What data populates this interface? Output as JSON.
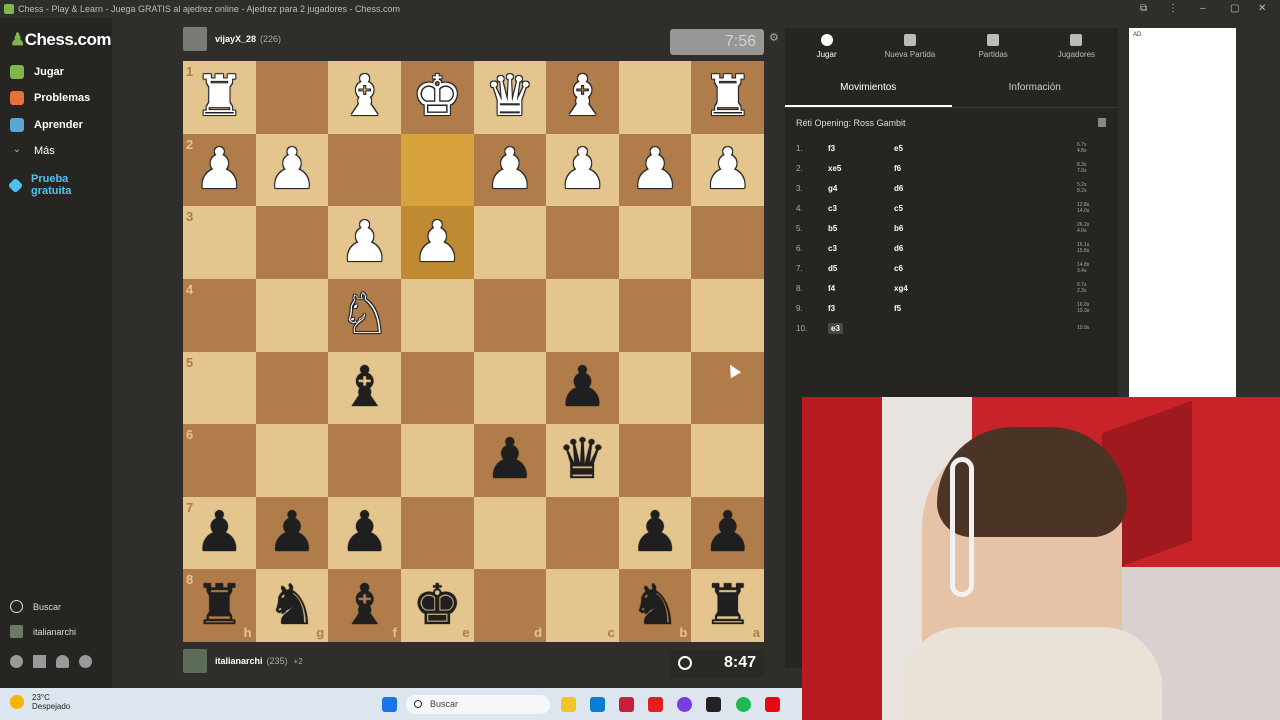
{
  "window": {
    "title": "Chess - Play & Learn - Juega GRATIS al ajedrez online - Ajedrez para 2 jugadores - Chess.com"
  },
  "sidebar": {
    "logo": "Chess.com",
    "items": [
      {
        "label": "Jugar",
        "icon": "play-hand-icon",
        "color": "#81b64c"
      },
      {
        "label": "Problemas",
        "icon": "puzzle-icon",
        "color": "#e6723a"
      },
      {
        "label": "Aprender",
        "icon": "learn-icon",
        "color": "#5aa6d6"
      },
      {
        "label": "Más",
        "icon": "chevron-down-icon",
        "color": "#bbbbbb"
      },
      {
        "label": "Prueba gratuita",
        "icon": "diamond-icon",
        "color": "#4ec3f0"
      }
    ],
    "search_label": "Buscar",
    "user": "italianarchi"
  },
  "top_player": {
    "name": "vijayX_28",
    "rating": "(226)",
    "clock": "7:56"
  },
  "bottom_player": {
    "name": "italianarchi",
    "rating": "(235)",
    "extra": "+2",
    "clock": "8:47"
  },
  "board": {
    "ranks": [
      "1",
      "2",
      "3",
      "4",
      "5",
      "6",
      "7",
      "8"
    ],
    "files": [
      "h",
      "g",
      "f",
      "e",
      "d",
      "c",
      "b",
      "a"
    ],
    "squares": [
      [
        "♜",
        "",
        "♝",
        "♚",
        "♛",
        "♝",
        "",
        "♜"
      ],
      [
        "♟",
        "♟",
        "",
        "",
        "♟",
        "♟",
        "♟",
        "♟"
      ],
      [
        "",
        "",
        "♟",
        "♟",
        "",
        "",
        "",
        ""
      ],
      [
        "",
        "",
        "♘",
        "",
        "",
        "",
        "",
        ""
      ],
      [
        "",
        "",
        "♝",
        "",
        "",
        "♟",
        "",
        ""
      ],
      [
        "",
        "",
        "",
        "",
        "♟",
        "♛",
        "",
        ""
      ],
      [
        "♟",
        "♟",
        "♟",
        "",
        "",
        "",
        "♟",
        "♟"
      ],
      [
        "♜",
        "♞",
        "♝",
        "♚",
        "",
        "",
        "♞",
        "♜"
      ]
    ],
    "colors": [
      [
        "w",
        "",
        "w",
        "w",
        "w",
        "w",
        "",
        "w"
      ],
      [
        "w",
        "w",
        "",
        "",
        "w",
        "w",
        "w",
        "w"
      ],
      [
        "",
        "",
        "w",
        "w",
        "",
        "",
        "",
        ""
      ],
      [
        "",
        "",
        "w",
        "",
        "",
        "",
        "",
        ""
      ],
      [
        "",
        "",
        "b",
        "",
        "",
        "b",
        "",
        ""
      ],
      [
        "",
        "",
        "",
        "",
        "b",
        "b",
        "",
        ""
      ],
      [
        "b",
        "b",
        "b",
        "",
        "",
        "",
        "b",
        "b"
      ],
      [
        "b",
        "b",
        "b",
        "b",
        "",
        "",
        "b",
        "b"
      ]
    ]
  },
  "panel": {
    "tabs": [
      {
        "label": "Jugar",
        "icon": "stopwatch-icon"
      },
      {
        "label": "Nueva Partida",
        "icon": "plus-icon"
      },
      {
        "label": "Partidas",
        "icon": "grid-icon"
      },
      {
        "label": "Jugadores",
        "icon": "players-icon"
      }
    ],
    "subtabs": [
      "Movimientos",
      "Información"
    ],
    "opening": "Réti Opening: Ross Gambit",
    "moves": [
      {
        "n": "1.",
        "w": "f3",
        "b": "e5",
        "tw": "6.7s",
        "tb": "4.8s"
      },
      {
        "n": "2.",
        "w": "xe5",
        "b": "f6",
        "tw": "8.3s",
        "tb": "7.0s"
      },
      {
        "n": "3.",
        "w": "g4",
        "b": "d6",
        "tw": "5.2s",
        "tb": "9.2s"
      },
      {
        "n": "4.",
        "w": "c3",
        "b": "c5",
        "tw": "12.8s",
        "tb": "14.0s"
      },
      {
        "n": "5.",
        "w": "b5",
        "b": "b6",
        "tw": "26.2s",
        "tb": "4.0s"
      },
      {
        "n": "6.",
        "w": "c3",
        "b": "d6",
        "tw": "16.1s",
        "tb": "15.8s"
      },
      {
        "n": "7.",
        "w": "d5",
        "b": "c6",
        "tw": "14.8s",
        "tb": "3.4s"
      },
      {
        "n": "8.",
        "w": "f4",
        "b": "xg4",
        "tw": "6.7s",
        "tb": "2.3s"
      },
      {
        "n": "9.",
        "w": "f3",
        "b": "f5",
        "tw": "16.0s",
        "tb": "10.3s"
      },
      {
        "n": "10.",
        "w": "e3",
        "b": "",
        "tw": "10.9s",
        "tb": ""
      }
    ]
  },
  "ad": {
    "label": "AD"
  },
  "taskbar": {
    "temp": "23°C",
    "weather": "Despejado",
    "search": "Buscar"
  }
}
